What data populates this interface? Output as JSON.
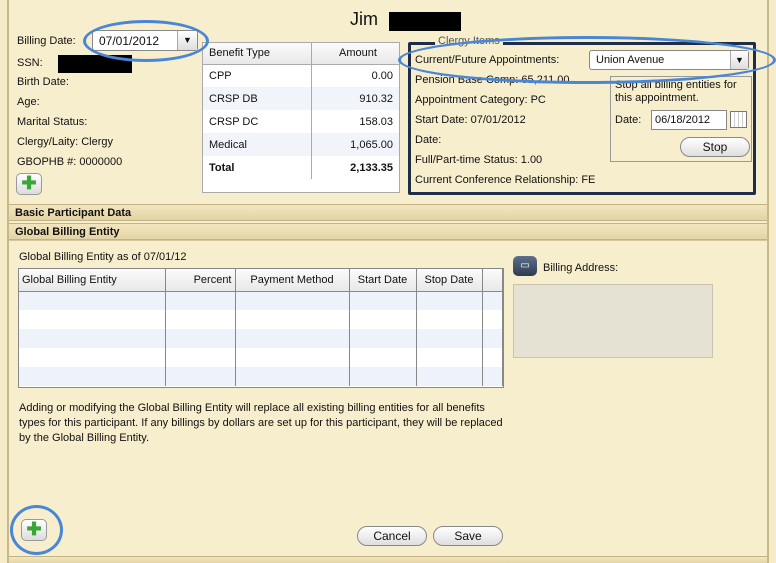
{
  "participant": {
    "name": "Jim"
  },
  "info": {
    "billing_date_label": "Billing Date:",
    "billing_date_value": "07/01/2012",
    "ssn_label": "SSN:",
    "birth_date_label": "Birth Date:",
    "age_label": "Age:",
    "marital_status_label": "Marital Status:",
    "clergy_laity_label": "Clergy/Laity:",
    "clergy_laity_value": "Clergy",
    "gbophb_label": "GBOPHB #:",
    "gbophb_value": "0000000"
  },
  "benefits": {
    "headers": [
      "Benefit Type",
      "Amount"
    ],
    "rows": [
      {
        "type": "CPP",
        "amount": "0.00"
      },
      {
        "type": "CRSP DB",
        "amount": "910.32"
      },
      {
        "type": "CRSP DC",
        "amount": "158.03"
      },
      {
        "type": "Medical",
        "amount": "1,065.00"
      }
    ],
    "total_label": "Total",
    "total_amount": "2,133.35"
  },
  "clergy": {
    "legend": "Clergy Items",
    "appointments_label": "Current/Future Appointments:",
    "appointment_value": "Union Avenue",
    "pension_label": "Pension Base Comp:",
    "pension_value": "65,211.00",
    "category_label": "Appointment Category:",
    "category_value": "PC",
    "start_date_label": "Start Date:",
    "start_date_value": "07/01/2012",
    "stop_date_label": "Date:",
    "status_label": "Full/Part-time Status:",
    "status_value": "1.00",
    "relationship_label": "Current Conference Relationship:",
    "relationship_value": "FE",
    "stop_text": "Stop all billing entities for this appointment.",
    "stop_date_value": "06/18/2012",
    "stop_button": "Stop"
  },
  "sections": {
    "basic": "Basic Participant Data",
    "global": "Global Billing Entity"
  },
  "global": {
    "as_of": "Global Billing Entity as of 07/01/12",
    "headers": [
      "Global Billing Entity",
      "Percent",
      "Payment Method",
      "Start Date",
      "Stop Date"
    ],
    "billing_address_label": "Billing Address:",
    "note": "Adding or modifying the Global Billing Entity will replace all existing billing entities for all benefits types for this participant.  If any billings by dollars are set up for this participant, they will be replaced by the Global Billing Entity.",
    "cancel_button": "Cancel",
    "save_button": "Save"
  },
  "icons": {
    "add": "plus-icon",
    "calendar": "calendar-icon",
    "billing_address": "card-icon"
  },
  "colors": {
    "highlight": "#4a86d6",
    "background": "#f7eecd",
    "clergy_border": "#1f2d4a"
  }
}
